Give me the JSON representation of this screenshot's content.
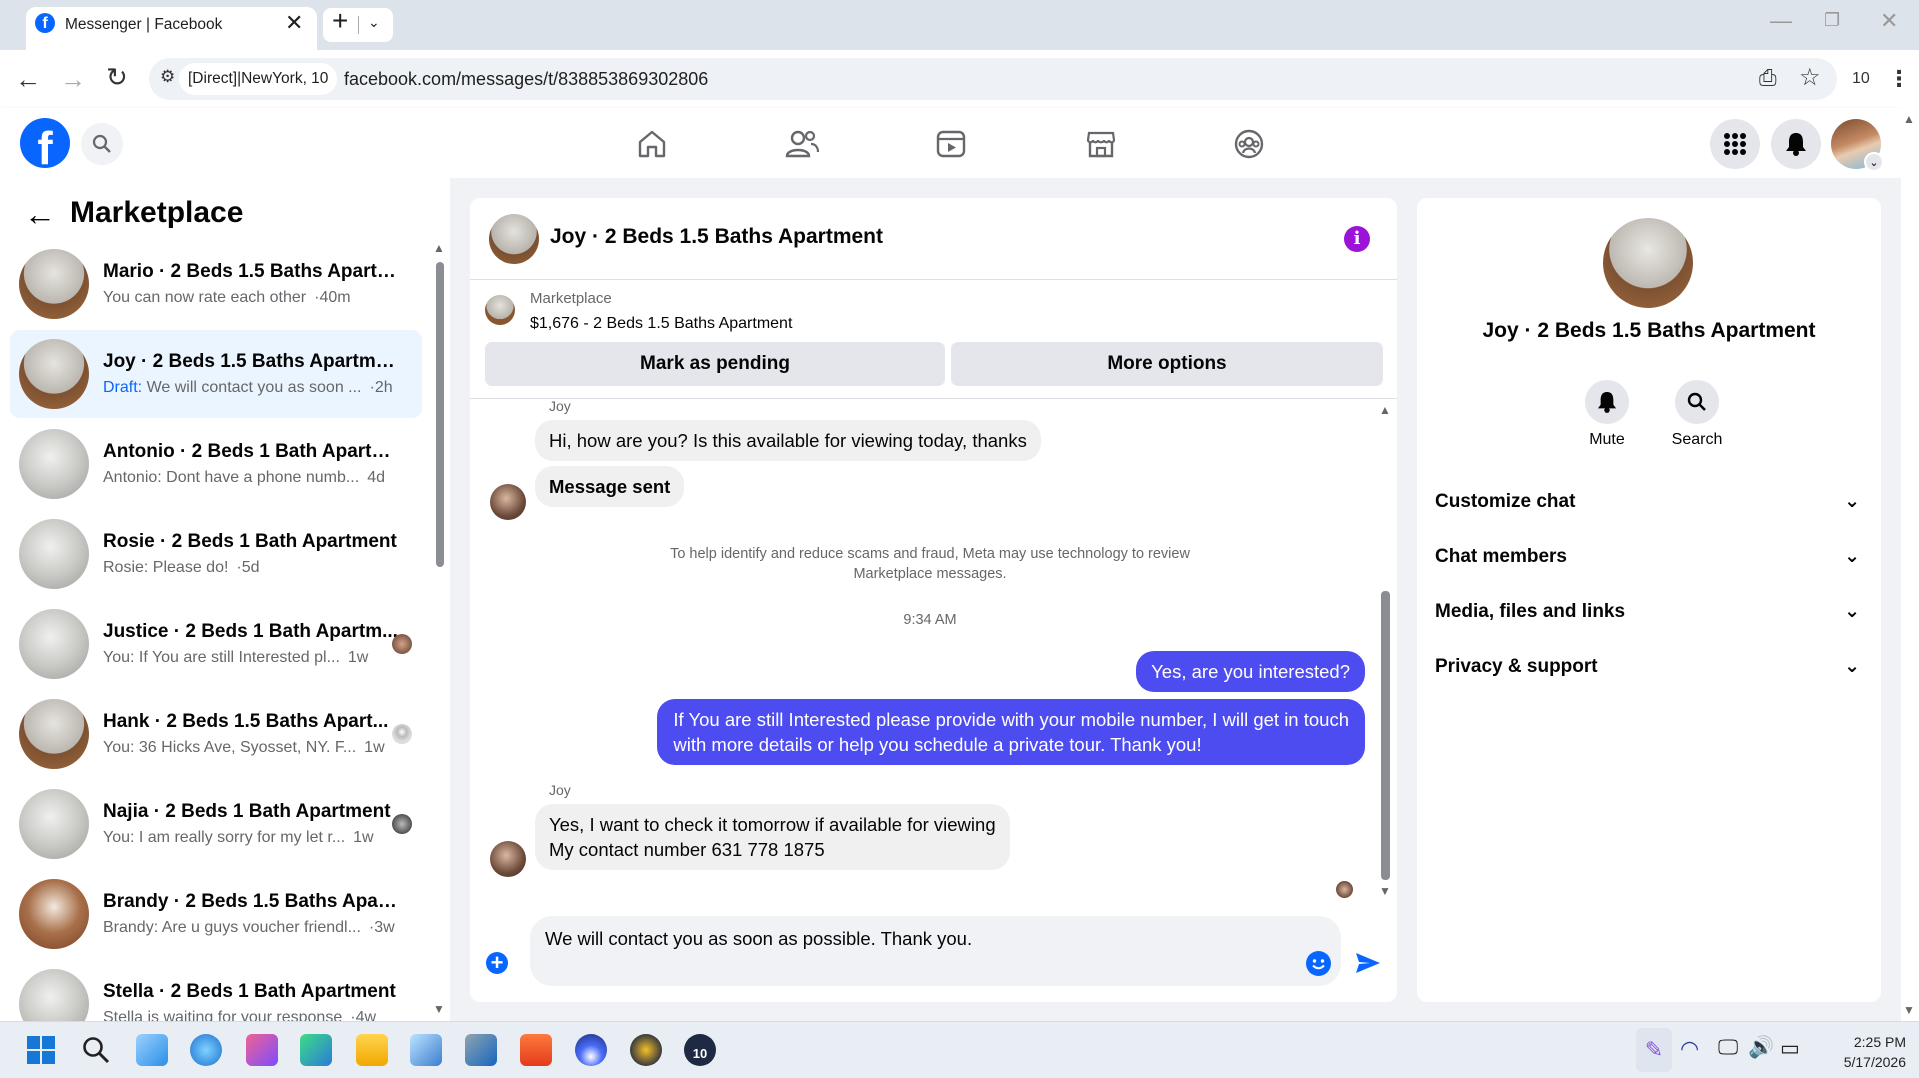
{
  "browser": {
    "tab_title": "Messenger | Facebook",
    "new_tab_symbol": "+",
    "proxy_label": "[Direct]|NewYork, 10",
    "url": "facebook.com/messages/t/838853869302806",
    "extension_count": "10"
  },
  "facebook_nav": {
    "icons": [
      "facebook-logo",
      "search-icon",
      "home-icon",
      "friends-icon",
      "watch-icon",
      "marketplace-icon",
      "groups-icon",
      "menu-grid-icon",
      "notifications-icon",
      "profile-avatar"
    ]
  },
  "sidebar": {
    "title": "Marketplace",
    "conversations": [
      {
        "title": "Mario · 2 Beds 1.5 Baths Apartm...",
        "preview": "You can now rate each other",
        "time": "·40m",
        "draft_label": ""
      },
      {
        "title": "Joy · 2 Beds 1.5 Baths Apartment",
        "preview": "We will contact you as soon ...",
        "time": "·2h",
        "draft_label": "Draft:"
      },
      {
        "title": "Antonio · 2 Beds 1 Bath Apartme...",
        "preview": "Antonio: Dont have a phone numb...",
        "time": "4d",
        "draft_label": ""
      },
      {
        "title": "Rosie · 2 Beds 1 Bath Apartment",
        "preview": "Rosie: Please do!",
        "time": "·5d",
        "draft_label": ""
      },
      {
        "title": "Justice · 2 Beds 1 Bath Apartm...",
        "preview": "You: If You are still Interested pl...",
        "time": "1w",
        "draft_label": ""
      },
      {
        "title": "Hank · 2 Beds 1.5 Baths Apart...",
        "preview": "You: 36 Hicks Ave, Syosset, NY. F...",
        "time": "1w",
        "draft_label": ""
      },
      {
        "title": "Najia · 2 Beds 1 Bath Apartment",
        "preview": "You: I am really sorry for my let r...",
        "time": "1w",
        "draft_label": ""
      },
      {
        "title": "Brandy · 2 Beds 1.5 Baths Apart...",
        "preview": "Brandy: Are u guys voucher friendl...",
        "time": "·3w",
        "draft_label": ""
      },
      {
        "title": "Stella · 2 Beds 1 Bath Apartment",
        "preview": "Stella is waiting for your response",
        "time": "·4w",
        "draft_label": ""
      }
    ]
  },
  "chat": {
    "header_title": "Joy · 2 Beds 1.5 Baths Apartment",
    "listing_source": "Marketplace",
    "listing_title": "$1,676 - 2 Beds 1.5 Baths Apartment",
    "mark_pending_label": "Mark as pending",
    "more_options_label": "More options",
    "sender_name_1": "Joy",
    "msg_1": "Hi, how are you? Is this available for viewing today, thanks",
    "msg_2": "Message sent",
    "notice_line1": "To help identify and reduce scams and fraud, Meta may use technology to review",
    "notice_line2": "Marketplace messages.",
    "timestamp": "9:34 AM",
    "msg_3": "Yes, are you interested?",
    "msg_4_line1": "If You are still Interested please provide with your mobile number, I will get in touch",
    "msg_4_line2": "with more details or help you schedule a private tour. Thank you!",
    "sender_name_2": "Joy",
    "msg_5_line1": "Yes, I want to check it tomorrow if available for viewing",
    "msg_5_line2": "My contact number 631 778 1875",
    "composer_text": "We will contact you as soon as possible. Thank you."
  },
  "info_panel": {
    "title": "Joy · 2 Beds 1.5 Baths Apartment",
    "mute_label": "Mute",
    "search_label": "Search",
    "sections": [
      "Customize chat",
      "Chat members",
      "Media, files and links",
      "Privacy & support"
    ]
  },
  "taskbar": {
    "time": "2:25 PM",
    "date": "5/17/2026",
    "app_badge": "10"
  },
  "colors": {
    "facebook_blue": "#0866ff",
    "outgoing_bubble": "#4d4cf0",
    "info_purple": "#9b12d9"
  }
}
